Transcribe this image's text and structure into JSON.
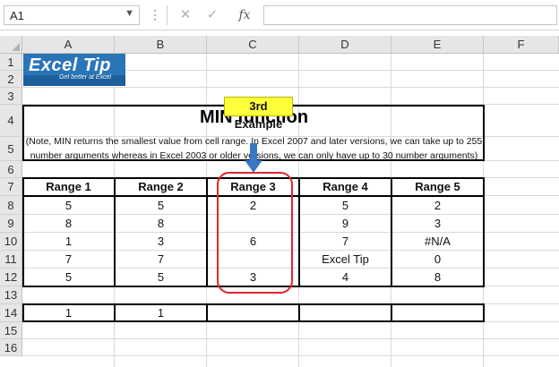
{
  "formula_bar": {
    "name_box": "A1",
    "dropdown_icon": "chevron-down-icon",
    "cancel_icon": "close-icon",
    "enter_icon": "checkmark-icon",
    "fx_label": "fx",
    "formula": ""
  },
  "columns": [
    "A",
    "B",
    "C",
    "D",
    "E",
    "F"
  ],
  "rows": [
    "1",
    "2",
    "3",
    "4",
    "5",
    "6",
    "7",
    "8",
    "9",
    "10",
    "11",
    "12",
    "13",
    "14",
    "15",
    "16"
  ],
  "logo": {
    "main": "Excel Tip",
    "sub": "Get better at Excel"
  },
  "title": "MIN function",
  "note_line1": "(Note, MIN returns the smallest value from cell range. In Excel 2007 and later versions, we can take up to 255",
  "note_line2": "number arguments whereas in Excel 2003 or older versions, we can only have up to 30 number arguments)",
  "table": {
    "headers": [
      "Range 1",
      "Range 2",
      "Range 3",
      "Range 4",
      "Range 5"
    ],
    "rows": [
      [
        "5",
        "5",
        "2",
        "5",
        "2"
      ],
      [
        "8",
        "8",
        "",
        "9",
        "3"
      ],
      [
        "1",
        "3",
        "6",
        "7",
        "#N/A"
      ],
      [
        "7",
        "7",
        "",
        "Excel Tip",
        "0"
      ],
      [
        "5",
        "5",
        "3",
        "4",
        "8"
      ]
    ]
  },
  "results": [
    "1",
    "1",
    "",
    "",
    ""
  ],
  "annotation": {
    "callout": "3rd Example",
    "highlight_color": "#e0252e",
    "callout_color": "#ffff3a"
  }
}
